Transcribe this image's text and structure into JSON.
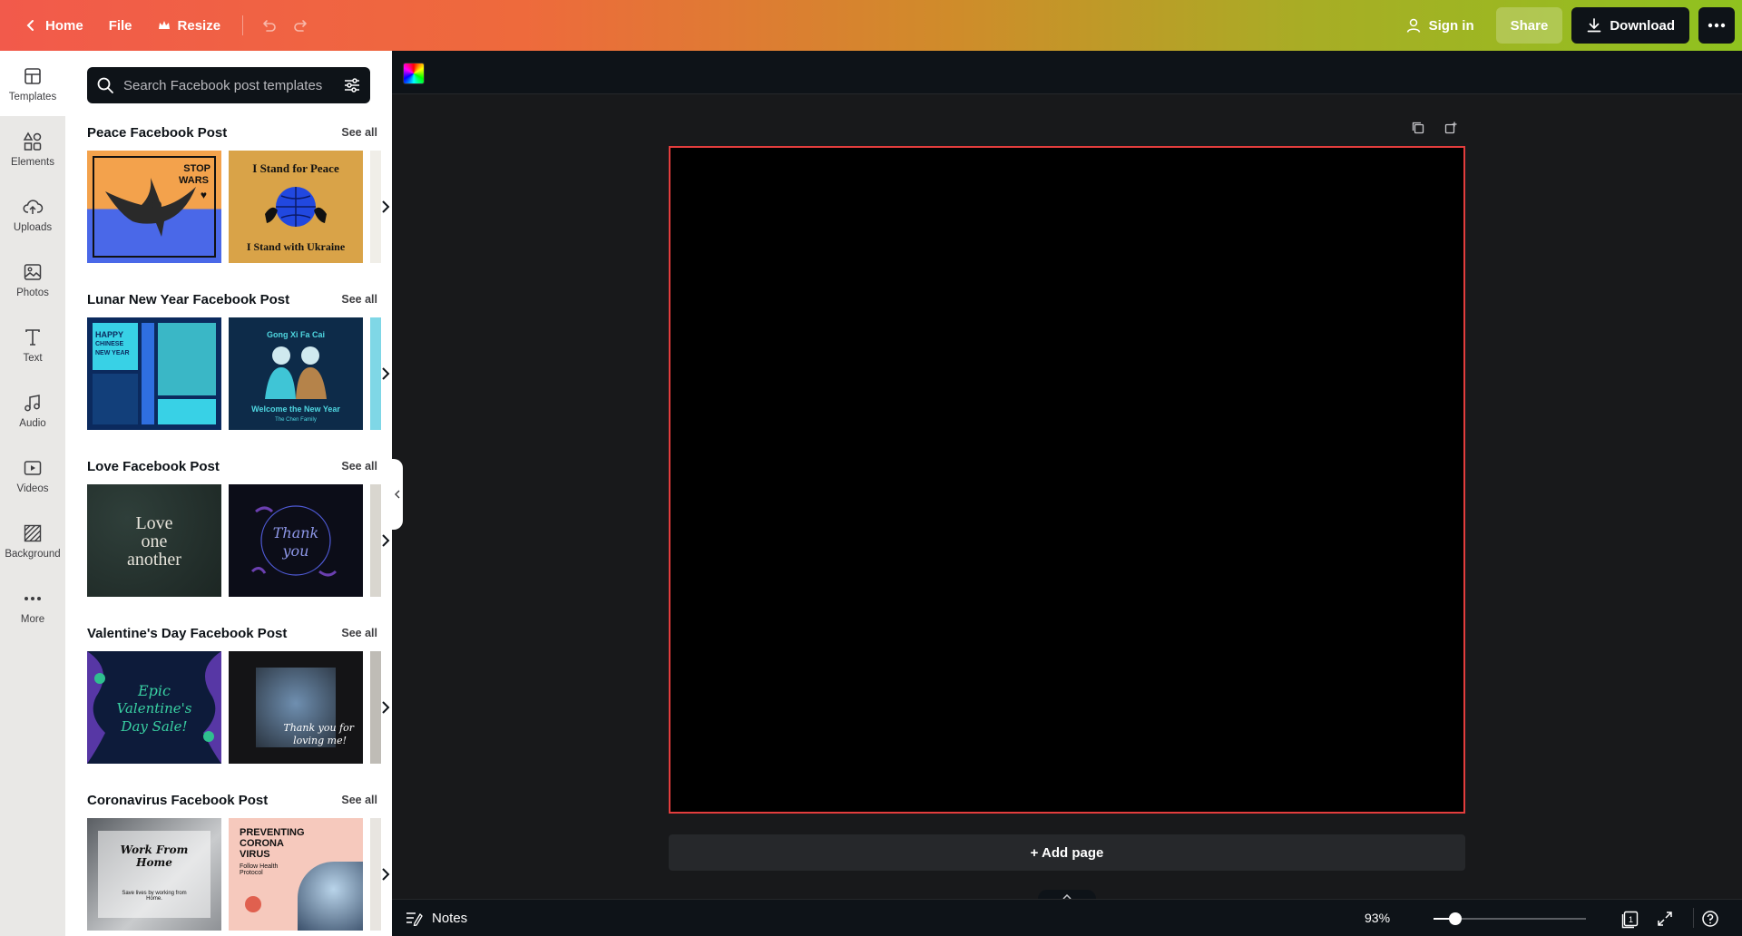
{
  "topbar": {
    "home_label": "Home",
    "file_label": "File",
    "resize_label": "Resize",
    "sign_in_label": "Sign in",
    "share_label": "Share",
    "download_label": "Download"
  },
  "rail": {
    "items": [
      {
        "label": "Templates",
        "icon": "templates-icon"
      },
      {
        "label": "Elements",
        "icon": "elements-icon"
      },
      {
        "label": "Uploads",
        "icon": "uploads-icon"
      },
      {
        "label": "Photos",
        "icon": "photos-icon"
      },
      {
        "label": "Text",
        "icon": "text-icon"
      },
      {
        "label": "Audio",
        "icon": "audio-icon"
      },
      {
        "label": "Videos",
        "icon": "videos-icon"
      },
      {
        "label": "Background",
        "icon": "background-icon"
      },
      {
        "label": "More",
        "icon": "more-icon"
      }
    ]
  },
  "panel": {
    "search_placeholder": "Search Facebook post templates",
    "see_all_label": "See all",
    "sections": [
      {
        "title": "Peace Facebook Post",
        "thumbs": [
          {
            "text1": "STOP",
            "text2": "WARS"
          },
          {
            "text1": "I Stand for Peace",
            "text2": "I Stand with Ukraine"
          }
        ]
      },
      {
        "title": "Lunar New Year Facebook Post",
        "thumbs": [
          {
            "text1": "HAPPY",
            "text2": "CHINESE",
            "text3": "NEW YEAR"
          },
          {
            "text1": "Gong Xi Fa Cai",
            "text2": "Welcome the New Year",
            "text3": "The Chen Family"
          }
        ]
      },
      {
        "title": "Love Facebook Post",
        "thumbs": [
          {
            "text1": "Love",
            "text2": "one",
            "text3": "another"
          },
          {
            "text1": "Thank",
            "text2": "you"
          }
        ]
      },
      {
        "title": "Valentine's Day Facebook Post",
        "thumbs": [
          {
            "text1": "Epic",
            "text2": "Valentine's",
            "text3": "Day Sale!"
          },
          {
            "text1": "Thank you for",
            "text2": "loving me!"
          }
        ]
      },
      {
        "title": "Coronavirus Facebook Post",
        "thumbs": [
          {
            "text1": "Work From",
            "text2": "Home",
            "text3": "Save lives by working from Home."
          },
          {
            "text1": "PREVENTING",
            "text2": "CORONA",
            "text3": "VIRUS",
            "text4": "Follow Health Protocol"
          }
        ]
      }
    ]
  },
  "editor": {
    "add_page_label": "+ Add page",
    "canvas_color": "#000000",
    "selection_color": "#e23d3d"
  },
  "bottombar": {
    "notes_label": "Notes",
    "zoom_label": "93%",
    "zoom_fraction": 0.14,
    "page_count": "1"
  }
}
